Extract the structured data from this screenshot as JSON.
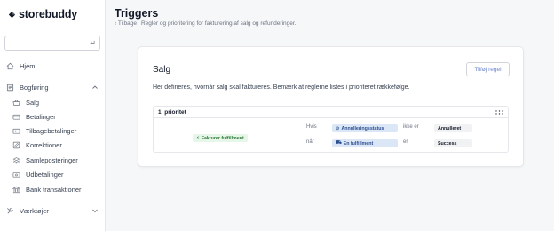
{
  "app": {
    "logo_text": "storebuddy"
  },
  "search": {
    "placeholder": "",
    "value": ""
  },
  "sidebar": {
    "items": [
      {
        "label": "Hjem",
        "icon": "home-icon"
      },
      {
        "label": "Bogføring",
        "icon": "ledger-icon",
        "expanded": true,
        "children": [
          {
            "label": "Salg",
            "icon": "basket-icon"
          },
          {
            "label": "Betalinger",
            "icon": "card-icon"
          },
          {
            "label": "Tilbagebetalinger",
            "icon": "refund-icon"
          },
          {
            "label": "Korrektioner",
            "icon": "edit-icon"
          },
          {
            "label": "Samleposteringer",
            "icon": "stack-icon"
          },
          {
            "label": "Udbetalinger",
            "icon": "payout-icon"
          },
          {
            "label": "Bank transaktioner",
            "icon": "bank-icon"
          }
        ]
      },
      {
        "label": "Værktøjer",
        "icon": "tools-icon",
        "expanded": false
      }
    ]
  },
  "header": {
    "title": "Triggers",
    "breadcrumb_back": "Tilbage",
    "breadcrumb_desc": "Regler og prioritering for fakturering af salg og refunderinger."
  },
  "card": {
    "title": "Salg",
    "add_button": "Tilføj regel",
    "description": "Her defineres, hvornår salg skal faktureres. Bemærk at reglerne listes i prioriteret rækkefølge."
  },
  "rule": {
    "priority_label": "1. prioritet",
    "action_label": "Fakturer fulfillment",
    "conditions": [
      {
        "connector": "Hvis",
        "field": "Annulleringsstatus",
        "operator": "ikke er",
        "value": "Annulleret"
      },
      {
        "connector": "når",
        "field": "En fulfillment",
        "operator": "er",
        "value": "Success"
      }
    ]
  },
  "colors": {
    "accent": "#6b86c9",
    "action_bg": "#e6f7e9",
    "field_bg": "#dbe6f7"
  }
}
